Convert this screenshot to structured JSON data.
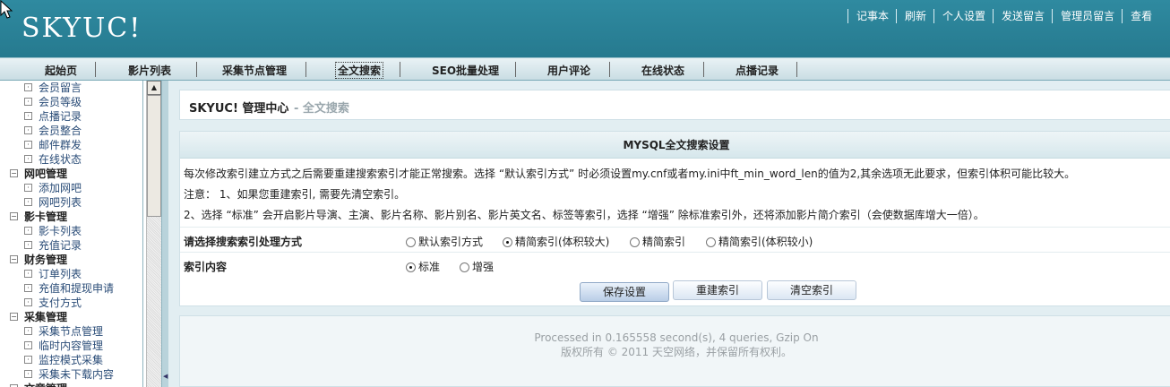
{
  "header": {
    "logo": "SKYUC!",
    "links": [
      "记事本",
      "刷新",
      "个人设置",
      "发送留言",
      "管理员留言",
      "查看"
    ]
  },
  "nav": {
    "items": [
      "起始页",
      "影片列表",
      "采集节点管理",
      "全文搜索",
      "SEO批量处理",
      "用户评论",
      "在线状态",
      "点播记录"
    ],
    "active": "全文搜索"
  },
  "sidebar": {
    "rows": [
      {
        "type": "sub",
        "label": "会员留言"
      },
      {
        "type": "sub",
        "label": "会员等级"
      },
      {
        "type": "sub",
        "label": "点播记录"
      },
      {
        "type": "sub",
        "label": "会员整合"
      },
      {
        "type": "sub",
        "label": "邮件群发"
      },
      {
        "type": "sub",
        "label": "在线状态"
      },
      {
        "type": "cat",
        "label": "网吧管理"
      },
      {
        "type": "sub",
        "label": "添加网吧"
      },
      {
        "type": "sub",
        "label": "网吧列表"
      },
      {
        "type": "cat",
        "label": "影卡管理"
      },
      {
        "type": "sub",
        "label": "影卡列表"
      },
      {
        "type": "sub",
        "label": "充值记录"
      },
      {
        "type": "cat",
        "label": "财务管理"
      },
      {
        "type": "sub",
        "label": "订单列表"
      },
      {
        "type": "sub",
        "label": "充值和提现申请"
      },
      {
        "type": "sub",
        "label": "支付方式"
      },
      {
        "type": "cat",
        "label": "采集管理"
      },
      {
        "type": "sub",
        "label": "采集节点管理"
      },
      {
        "type": "sub",
        "label": "临时内容管理"
      },
      {
        "type": "sub",
        "label": "监控模式采集"
      },
      {
        "type": "sub",
        "label": "采集未下载内容"
      },
      {
        "type": "cat",
        "label": "文章管理"
      }
    ]
  },
  "breadcrumb": {
    "title": "SKYUC! 管理中心",
    "sub": "- 全文搜索"
  },
  "panel": {
    "heading": "MYSQL全文搜索设置",
    "line1": "每次修改索引建立方式之后需要重建搜索索引才能正常搜索。选择 “默认索引方式” 时必须设置my.cnf或者my.ini中ft_min_word_len的值为2,其余选项无此要求，但索引体积可能比较大。",
    "line2": "注意： 1、如果您重建索引, 需要先清空索引。",
    "line3": "2、选择 “标准” 会开启影片导演、主演、影片名称、影片别名、影片英文名、标签等索引，选择 “增强” 除标准索引外，还将添加影片简介索引（会使数据库增大一倍）。",
    "mode": {
      "label": "请选择搜索索引处理方式",
      "options": [
        "默认索引方式",
        "精简索引(体积较大)",
        "精简索引",
        "精简索引(体积较小)"
      ],
      "selected": 1
    },
    "content": {
      "label": "索引内容",
      "options": [
        "标准",
        "增强"
      ],
      "selected": 0
    },
    "buttons": {
      "save": "保存设置",
      "rebuild": "重建索引",
      "clear": "清空索引"
    }
  },
  "footer": {
    "processed": "Processed in 0.165558 second(s), 4 queries, Gzip On",
    "copyright": "版权所有 © 2011 天空网络，并保留所有权利。"
  },
  "colors": {
    "header": "#2f8aa0",
    "nav": "#d6e7ec",
    "main_bg": "#e2eef2"
  }
}
